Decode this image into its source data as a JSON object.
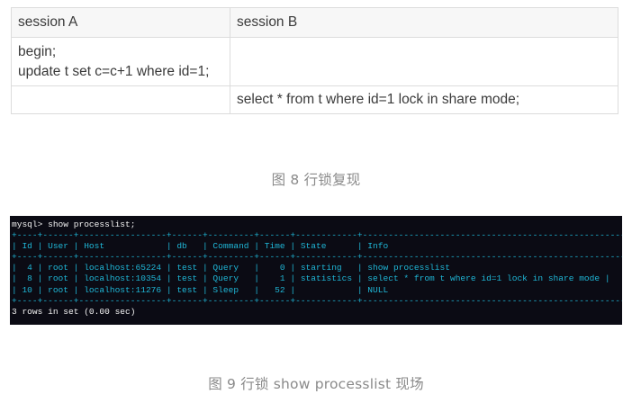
{
  "table": {
    "headers": [
      "session A",
      "session B"
    ],
    "rows": [
      {
        "a": [
          "begin;",
          "update t set c=c+1 where id=1;"
        ],
        "b": [
          ""
        ]
      },
      {
        "a": [
          ""
        ],
        "b": [
          "select * from t where id=1 lock in share mode;"
        ]
      }
    ]
  },
  "captions": {
    "figure8": "图 8 行锁复现",
    "figure9": "图 9 行锁 show processlist 现场"
  },
  "terminal": {
    "command": "mysql> show processlist;",
    "border": "+----+------+-----------------+------+---------+------+------------+-----------------------------------------------------+",
    "header": "| Id | User | Host            | db   | Command | Time | State      | Info                                                |",
    "rows": [
      "|  4 | root | localhost:65224 | test | Query   |    0 | starting   | show processlist                                    |",
      "|  8 | root | localhost:10354 | test | Query   |    1 | statistics | select * from t where id=1 lock in share mode |",
      "| 10 | root | localhost:11276 | test | Sleep   |   52 |            | NULL                                                |"
    ],
    "footer": "3 rows in set (0.00 sec)"
  },
  "colors": {
    "terminal_bg": "#0b0b14",
    "terminal_border": "#1fb6d6",
    "terminal_text": "#f2f2f2",
    "caption": "#8a8a8a"
  }
}
